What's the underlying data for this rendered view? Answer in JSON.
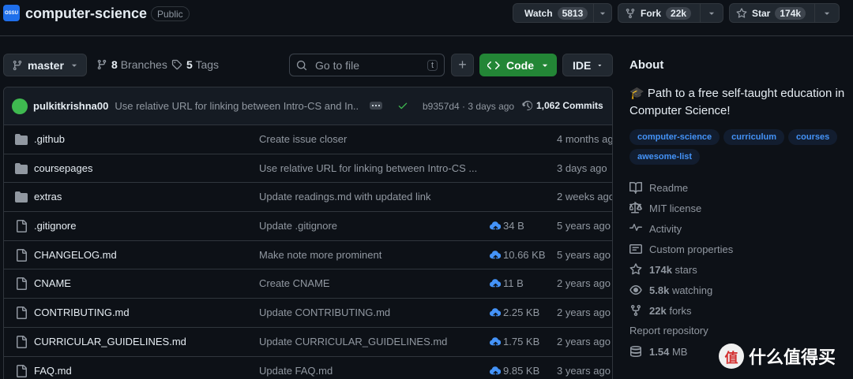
{
  "header": {
    "org_avatar_text": "OSSU",
    "repo_name": "computer-science",
    "visibility": "Public",
    "watch_label": "Watch",
    "watch_count": "5813",
    "fork_label": "Fork",
    "fork_count": "22k",
    "star_label": "Star",
    "star_count": "174k"
  },
  "toolbar": {
    "branch": "master",
    "branches_count": "8",
    "branches_label": "Branches",
    "tags_count": "5",
    "tags_label": "Tags",
    "search_placeholder": "Go to file",
    "search_shortcut": "t",
    "code_label": "Code",
    "ide_label": "IDE"
  },
  "latest_commit": {
    "author": "pulkitkrishna00",
    "message": "Use relative URL for linking between Intro-CS and In...",
    "sha_and_time": "b9357d4 · 3 days ago",
    "commit_count": "1,062 Commits"
  },
  "files": [
    {
      "name": ".github",
      "type": "folder",
      "message": "Create issue closer",
      "size": "",
      "date": "4 months ago"
    },
    {
      "name": "coursepages",
      "type": "folder",
      "message": "Use relative URL for linking between Intro-CS ...",
      "size": "",
      "date": "3 days ago"
    },
    {
      "name": "extras",
      "type": "folder",
      "message": "Update readings.md with updated link",
      "size": "",
      "date": "2 weeks ago"
    },
    {
      "name": ".gitignore",
      "type": "file",
      "message": "Update .gitignore",
      "size": "34 B",
      "date": "5 years ago"
    },
    {
      "name": "CHANGELOG.md",
      "type": "file",
      "message": "Make note more prominent",
      "size": "10.66 KB",
      "date": "5 years ago"
    },
    {
      "name": "CNAME",
      "type": "file",
      "message": "Create CNAME",
      "size": "11 B",
      "date": "2 years ago"
    },
    {
      "name": "CONTRIBUTING.md",
      "type": "file",
      "message": "Update CONTRIBUTING.md",
      "size": "2.25 KB",
      "date": "2 years ago"
    },
    {
      "name": "CURRICULAR_GUIDELINES.md",
      "type": "file",
      "message": "Update CURRICULAR_GUIDELINES.md",
      "size": "1.75 KB",
      "date": "2 years ago"
    },
    {
      "name": "FAQ.md",
      "type": "file",
      "message": "Update FAQ.md",
      "size": "9.85 KB",
      "date": "3 years ago"
    }
  ],
  "about": {
    "title": "About",
    "description": "🎓 Path to a free self-taught education in Computer Science!",
    "topics": [
      "computer-science",
      "curriculum",
      "courses",
      "awesome-list"
    ],
    "readme": "Readme",
    "license": "MIT license",
    "activity": "Activity",
    "custom_properties": "Custom properties",
    "stars_count": "174k",
    "stars_label": "stars",
    "watching_count": "5.8k",
    "watching_label": "watching",
    "forks_count": "22k",
    "forks_label": "forks",
    "report": "Report repository",
    "size_value": "1.54",
    "size_unit": "MB"
  },
  "watermark": {
    "logo_text": "值",
    "text": "什么值得买"
  },
  "colors": {
    "background": "#0d1117",
    "border": "#30363d",
    "code_button": "#238636",
    "link_blue": "#4493f8",
    "muted_text": "#9198a1"
  }
}
